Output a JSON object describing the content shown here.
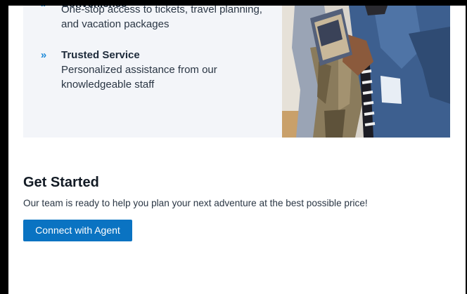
{
  "features": [
    {
      "icon": "double-chevron-right-icon",
      "title": "Convenience",
      "description": "One-stop access to tickets, travel planning, and vacation packages"
    },
    {
      "icon": "double-chevron-right-icon",
      "title": "Trusted Service",
      "description": "Personalized assistance from our knowledgeable staff"
    }
  ],
  "chevron_glyph": "»",
  "get_started": {
    "title": "Get Started",
    "text": "Our team is ready to help you plan your next adventure at the best possible price!",
    "button_label": "Connect with Agent"
  },
  "colors": {
    "accent": "#1a88d8",
    "button": "#0a73c2",
    "panel_bg": "#f3f5f9"
  }
}
